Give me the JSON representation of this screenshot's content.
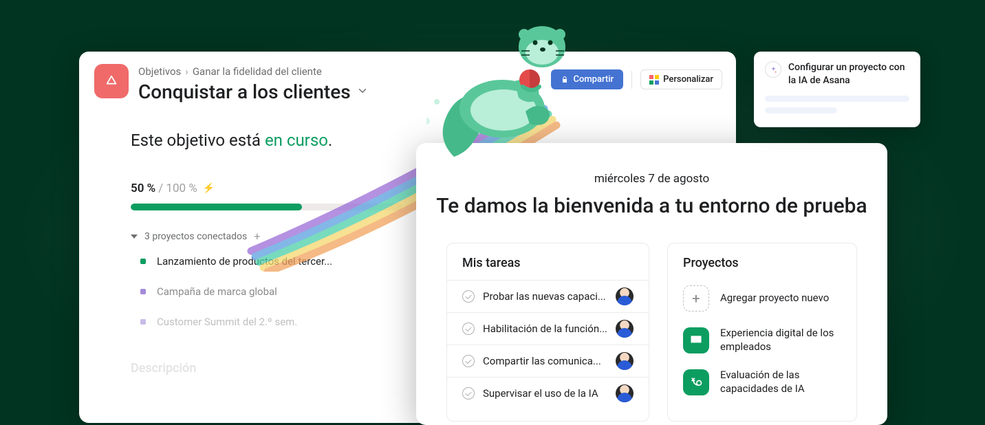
{
  "breadcrumbs": {
    "root": "Objetivos",
    "current": "Ganar la fidelidad del cliente"
  },
  "objective": {
    "title": "Conquistar a los clientes",
    "share_label": "Compartir",
    "customize_label": "Personalizar",
    "status_prefix": "Este objetivo está ",
    "status_accent": "en curso",
    "status_suffix": ".",
    "progress_current": "50 %",
    "progress_max": "/ 100 %",
    "connected_projects_label": "3 proyectos conectados",
    "projects": [
      {
        "label": "Lanzamiento de productos del tercer..."
      },
      {
        "label": "Campaña de marca global"
      },
      {
        "label": "Customer Summit del 2.º sem."
      }
    ],
    "description_heading": "Descripción"
  },
  "dashboard": {
    "date": "miércoles 7 de agosto",
    "welcome": "Te damos la bienvenida a tu entorno de prueba",
    "tasks_title": "Mis tareas",
    "tasks": [
      {
        "label": "Probar las nuevas capaci..."
      },
      {
        "label": "Habilitación de la función..."
      },
      {
        "label": "Compartir las comunica..."
      },
      {
        "label": "Supervisar el uso de la IA"
      }
    ],
    "projects_title": "Proyectos",
    "add_project_label": "Agregar proyecto nuevo",
    "project_items": [
      {
        "label": "Experiencia digital de los empleados"
      },
      {
        "label": "Evaluación de las capacidades de IA"
      }
    ]
  },
  "ai_card": {
    "text": "Configurar un proyecto con la IA de Asana"
  }
}
